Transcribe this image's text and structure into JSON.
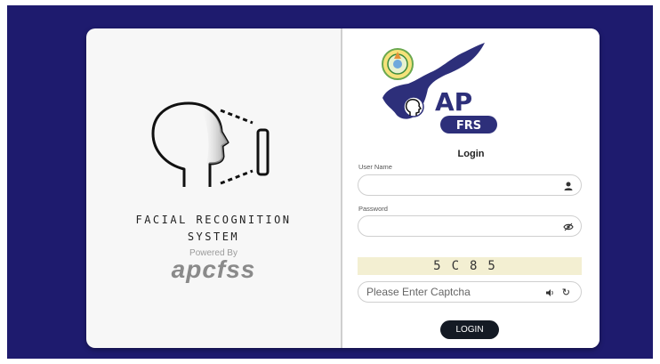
{
  "brand": {
    "system_title_line1": "FACIAL RECOGNITION",
    "system_title_line2": "SYSTEM",
    "powered_by": "Powered By",
    "org_logo_text": "apcfss"
  },
  "logo": {
    "abbr": "AP",
    "sub": "FRS"
  },
  "login": {
    "heading": "Login",
    "username_label": "User Name",
    "username_value": "",
    "password_label": "Password",
    "password_value": "",
    "captcha_code": "5C85",
    "captcha_placeholder": "Please Enter Captcha",
    "button_label": "LOGIN"
  },
  "colors": {
    "page_background": "#1e1b6e",
    "map_fill": "#2d2f7a",
    "button": "#141a24",
    "captcha_bg": "#f3efd2"
  },
  "icons": [
    "face-scan-illustration",
    "user-icon",
    "eye-icon",
    "speaker-icon",
    "refresh-icon",
    "state-emblem-icon",
    "state-map-logo"
  ]
}
